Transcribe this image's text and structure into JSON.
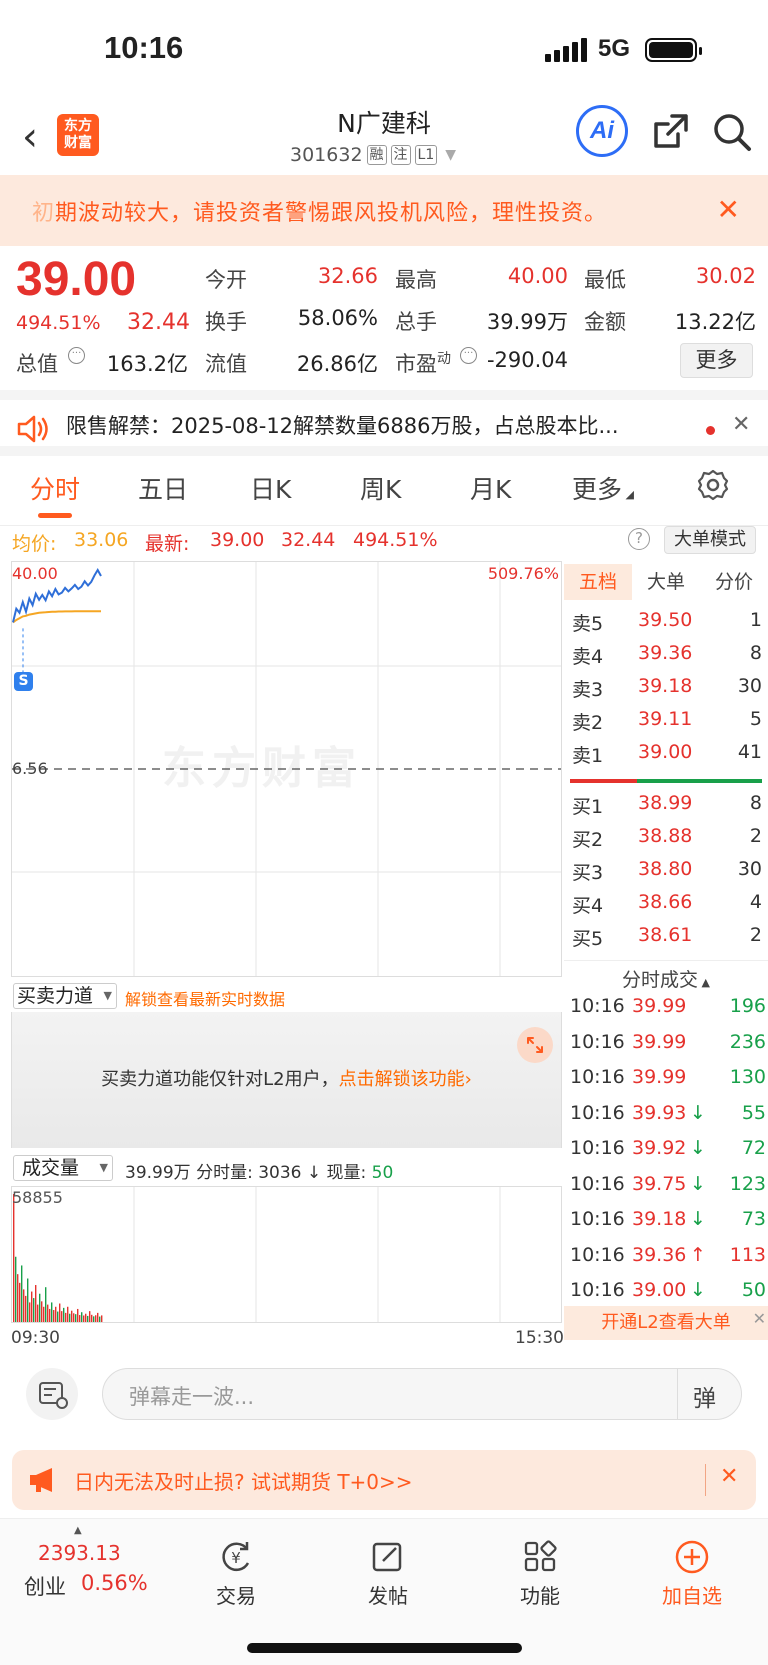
{
  "status": {
    "time": "10:16",
    "network": "5G"
  },
  "header": {
    "logo_line1": "东方",
    "logo_line2": "财富",
    "stock_name": "N广建科",
    "stock_code": "301632",
    "tags": [
      "融",
      "注",
      "L1"
    ],
    "ai_label": "Ai"
  },
  "warning": {
    "prefix": "初",
    "text": "期波动较大，请投资者警惕跟风投机风险，理性投资。"
  },
  "quote": {
    "price": "39.00",
    "change_pct": "494.51%",
    "change": "32.44",
    "fields": [
      {
        "label": "今开",
        "value": "32.66",
        "color": "red"
      },
      {
        "label": "最高",
        "value": "40.00",
        "color": "red"
      },
      {
        "label": "最低",
        "value": "30.02",
        "color": "red"
      },
      {
        "label": "换手",
        "value": "58.06%",
        "color": "dark"
      },
      {
        "label": "总手",
        "value": "39.99万",
        "color": "dark"
      },
      {
        "label": "金额",
        "value": "13.22亿",
        "color": "dark"
      },
      {
        "label": "总值",
        "value": "163.2亿",
        "color": "dark"
      },
      {
        "label": "流值",
        "value": "26.86亿",
        "color": "dark"
      },
      {
        "label": "市盈",
        "value": "-290.04",
        "color": "dark"
      }
    ],
    "pe_superscript": "动",
    "more_label": "更多"
  },
  "notice": {
    "text": "限售解禁：2025-08-12解禁数量6886万股，占总股本比..."
  },
  "tabs": [
    "分时",
    "五日",
    "日K",
    "周K",
    "月K",
    "更多"
  ],
  "avg_bar": {
    "avg_label": "均价:",
    "avg_value": "33.06",
    "latest_label": "最新:",
    "latest_price": "39.00",
    "latest_change": "32.44",
    "latest_pct": "494.51%",
    "mode_button": "大单模式"
  },
  "chart_data": {
    "type": "line",
    "price_top_label": "40.00",
    "pct_top_label": "509.76%",
    "prev_close_label": "6.56",
    "marker": "S",
    "x_start": "09:30",
    "x_end": "15:30",
    "watermark": "东方财富",
    "price_series": [
      31.2,
      33.5,
      32.8,
      34.6,
      33.0,
      35.2,
      34.1,
      36.0,
      35.0,
      35.8,
      34.9,
      36.4,
      35.6,
      36.8,
      35.9,
      36.2,
      37.0,
      36.4,
      36.9,
      37.5,
      36.8,
      37.2,
      38.1,
      37.4,
      38.0,
      39.1,
      40.0,
      39.0
    ],
    "avg_series": [
      31.2,
      31.6,
      31.9,
      32.2,
      32.3,
      32.5,
      32.6,
      32.7,
      32.8,
      32.85,
      32.9,
      32.95,
      33.0,
      33.0,
      33.02,
      33.03,
      33.04,
      33.05,
      33.05,
      33.06,
      33.06,
      33.06,
      33.06,
      33.06,
      33.06,
      33.06,
      33.06,
      33.06
    ],
    "ylim": [
      6.56,
      40.0
    ]
  },
  "book": {
    "tabs": [
      "五档",
      "大单",
      "分价"
    ],
    "sell": [
      {
        "label": "卖5",
        "price": "39.50",
        "vol": "1"
      },
      {
        "label": "卖4",
        "price": "39.36",
        "vol": "8"
      },
      {
        "label": "卖3",
        "price": "39.18",
        "vol": "30"
      },
      {
        "label": "卖2",
        "price": "39.11",
        "vol": "5"
      },
      {
        "label": "卖1",
        "price": "39.00",
        "vol": "41"
      }
    ],
    "buy": [
      {
        "label": "买1",
        "price": "38.99",
        "vol": "8"
      },
      {
        "label": "买2",
        "price": "38.88",
        "vol": "2"
      },
      {
        "label": "买3",
        "price": "38.80",
        "vol": "30"
      },
      {
        "label": "买4",
        "price": "38.66",
        "vol": "4"
      },
      {
        "label": "买5",
        "price": "38.61",
        "vol": "2"
      }
    ]
  },
  "force": {
    "select_label": "买卖力道",
    "unlock_hint": "解锁查看最新实时数据",
    "box_text": "买卖力道功能仅针对L2用户，",
    "box_link": "点击解锁该功能"
  },
  "volume": {
    "select_label": "成交量",
    "summary": "39.99万 分时量: 3036 ↓ 现量: ",
    "current": "50",
    "max_label": "58855",
    "bars": [
      58855,
      30000,
      22000,
      18000,
      26000,
      15000,
      12000,
      20000,
      9000,
      14000,
      11000,
      17000,
      8000,
      13000,
      9500,
      7000,
      16000,
      8000,
      6000,
      9000,
      5500,
      7000,
      4800,
      8500,
      5000,
      6500,
      4200,
      7000,
      3800,
      5200,
      4000,
      3600,
      6000,
      3200,
      4500,
      3000,
      3800,
      2800,
      5000,
      3300,
      2600,
      3100,
      4200,
      2500,
      3036
    ]
  },
  "ticks": {
    "title": "分时成交",
    "rows": [
      {
        "time": "10:16",
        "price": "39.99",
        "arrow": "",
        "vol": "196"
      },
      {
        "time": "10:16",
        "price": "39.99",
        "arrow": "",
        "vol": "236"
      },
      {
        "time": "10:16",
        "price": "39.99",
        "arrow": "",
        "vol": "130"
      },
      {
        "time": "10:16",
        "price": "39.93",
        "arrow": "↓",
        "vol": "55"
      },
      {
        "time": "10:16",
        "price": "39.92",
        "arrow": "↓",
        "vol": "72"
      },
      {
        "time": "10:16",
        "price": "39.75",
        "arrow": "↓",
        "vol": "123"
      },
      {
        "time": "10:16",
        "price": "39.18",
        "arrow": "↓",
        "vol": "73"
      },
      {
        "time": "10:16",
        "price": "39.36",
        "arrow": "↑",
        "vol": "113"
      },
      {
        "time": "10:16",
        "price": "39.00",
        "arrow": "↓",
        "vol": "50"
      }
    ],
    "vol_colors": [
      "green",
      "green",
      "green",
      "green",
      "green",
      "green",
      "green",
      "red",
      "green"
    ],
    "l2_banner": "开通L2查看大单"
  },
  "danmaku": {
    "placeholder": "弹幕走一波...",
    "send_label": "弹"
  },
  "futures": {
    "text": "日内无法及时止损? 试试期货 T+0>>"
  },
  "nav": {
    "index_value": "2393.13",
    "index_name": "创业",
    "index_pct": "0.56%",
    "items": [
      "交易",
      "发帖",
      "功能",
      "加自选"
    ]
  }
}
